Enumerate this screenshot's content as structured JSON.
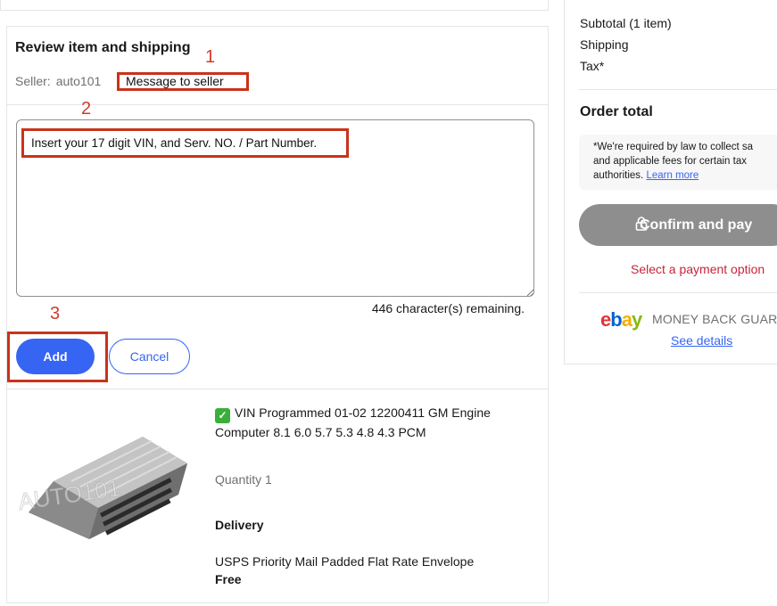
{
  "review": {
    "title": "Review item and shipping",
    "seller_label": "Seller:",
    "seller_name": "auto101",
    "message_link": "Message to seller"
  },
  "annotations": [
    "1",
    "2",
    "3"
  ],
  "message": {
    "text": "Insert your 17 digit VIN, and Serv. NO. / Part Number.",
    "chars_remaining": "446 character(s) remaining."
  },
  "actions": {
    "add_label": "Add",
    "cancel_label": "Cancel"
  },
  "item": {
    "title": "VIN Programmed 01-02 12200411 GM Engine Computer 8.1 6.0 5.7 5.3 4.8 4.3 PCM",
    "quantity": "Quantity 1",
    "delivery_heading": "Delivery",
    "shipping_method": "USPS Priority Mail Padded Flat Rate Envelope",
    "shipping_price": "Free",
    "watermark": "AUTO101"
  },
  "summary": {
    "subtotal_label": "Subtotal (1 item)",
    "shipping_label": "Shipping",
    "tax_label": "Tax*",
    "order_total_label": "Order total",
    "legal_line1": "*We're required by law to collect sa",
    "legal_line2": "and applicable fees for certain tax",
    "legal_line3": "authorities.",
    "learn_more": "Learn more",
    "confirm_label": "Confirm and pay",
    "payment_warning": "Select a payment option",
    "guarantee_text": "MONEY BACK GUARA",
    "see_details": "See details"
  },
  "logo": {
    "letters": [
      "e",
      "b",
      "a",
      "y"
    ],
    "colors": [
      "#e53238",
      "#0064d2",
      "#f5af02",
      "#86b817"
    ]
  },
  "colors": {
    "accent_blue": "#3665f3",
    "annotation_red": "#c93319",
    "warning_red": "#c7243a",
    "check_green": "#3aae3a",
    "disabled_gray": "#8e8e8e"
  }
}
